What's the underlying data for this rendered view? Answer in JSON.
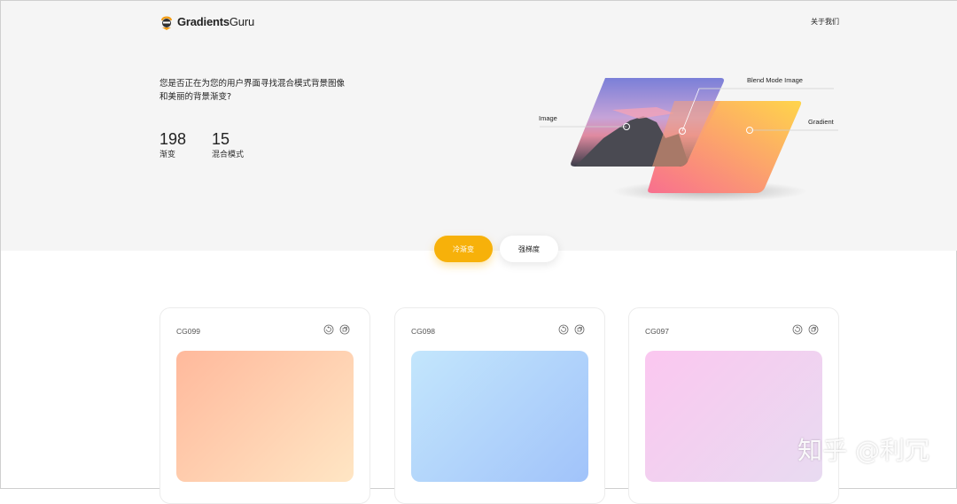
{
  "header": {
    "logo_word1": "Gradients",
    "logo_word2": "Guru",
    "about_label": "关于我们"
  },
  "hero": {
    "tagline": "您是否正在为您的用户界面寻找混合模式背景图像和美丽的背景渐变?",
    "stats": [
      {
        "value": "198",
        "label": "渐变"
      },
      {
        "value": "15",
        "label": "混合模式"
      }
    ],
    "illustration_labels": {
      "image": "Image",
      "blend": "Blend Mode Image",
      "gradient": "Gradient"
    }
  },
  "tabs": [
    {
      "label": "冷渐变",
      "active": true
    },
    {
      "label": "强梯度",
      "active": false
    }
  ],
  "cards": [
    {
      "title": "CG099",
      "from": "#ffb99c",
      "to": "#ffe6c4"
    },
    {
      "title": "CG098",
      "from": "#c3e6fc",
      "to": "#a1c3fa"
    },
    {
      "title": "CG097",
      "from": "#fbc7f0",
      "to": "#e8dbf1"
    }
  ],
  "watermark": "知乎 @利冗",
  "colors": {
    "accent": "#f7b10a"
  },
  "icons": {
    "restart": "restart-icon",
    "copy": "copy-icon"
  }
}
